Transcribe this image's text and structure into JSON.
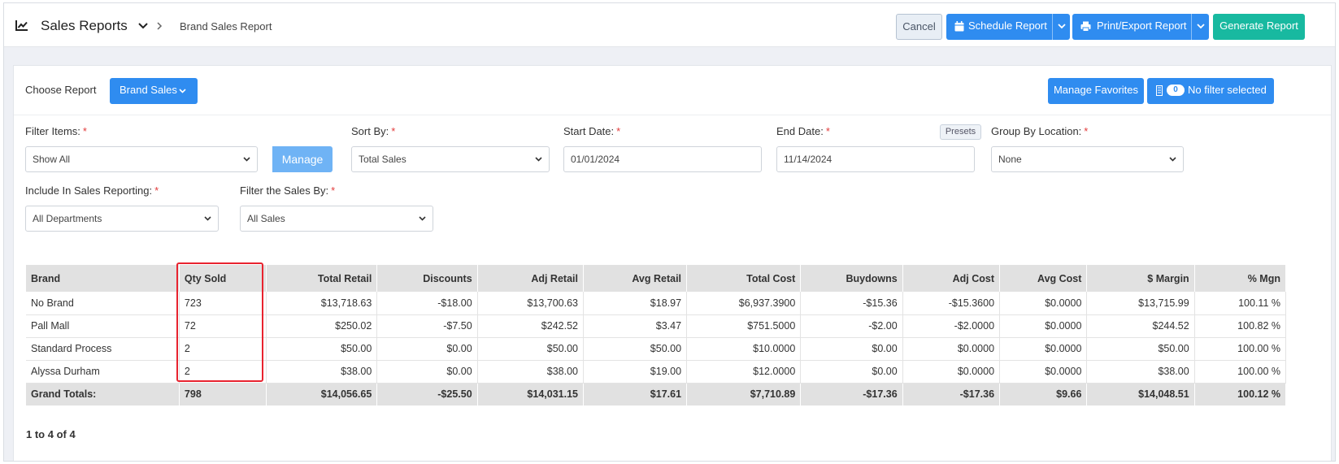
{
  "header": {
    "title": "Sales Reports",
    "breadcrumb": "Brand Sales Report",
    "cancel_label": "Cancel",
    "schedule_label": "Schedule Report",
    "print_label": "Print/Export Report",
    "generate_label": "Generate Report"
  },
  "report_bar": {
    "choose_label": "Choose Report",
    "report_selected": "Brand Sales",
    "manage_favorites_label": "Manage Favorites",
    "filter_count": "0",
    "filter_status": "No filter selected"
  },
  "filters": {
    "filter_items": {
      "label": "Filter Items:",
      "value": "Show All",
      "manage_label": "Manage"
    },
    "sort_by": {
      "label": "Sort By:",
      "value": "Total Sales"
    },
    "start_date": {
      "label": "Start Date:",
      "value": "01/01/2024"
    },
    "end_date": {
      "label": "End Date:",
      "value": "11/14/2024",
      "presets_label": "Presets"
    },
    "group_by_location": {
      "label": "Group By Location:",
      "value": "None"
    },
    "include_in_sales": {
      "label": "Include In Sales Reporting:",
      "value": "All Departments"
    },
    "filter_sales_by": {
      "label": "Filter the Sales By:",
      "value": "All Sales"
    },
    "required_mark": "*"
  },
  "table": {
    "columns": [
      "Brand",
      "Qty Sold",
      "Total Retail",
      "Discounts",
      "Adj Retail",
      "Avg Retail",
      "Total Cost",
      "Buydowns",
      "Adj Cost",
      "Avg Cost",
      "$ Margin",
      "% Mgn"
    ],
    "rows": [
      [
        "No Brand",
        "723",
        "$13,718.63",
        "-$18.00",
        "$13,700.63",
        "$18.97",
        "$6,937.3900",
        "-$15.36",
        "-$15.3600",
        "$0.0000",
        "$13,715.99",
        "100.11 %"
      ],
      [
        "Pall Mall",
        "72",
        "$250.02",
        "-$7.50",
        "$242.52",
        "$3.47",
        "$751.5000",
        "-$2.00",
        "-$2.0000",
        "$0.0000",
        "$244.52",
        "100.82 %"
      ],
      [
        "Standard Process",
        "2",
        "$50.00",
        "$0.00",
        "$50.00",
        "$50.00",
        "$10.0000",
        "$0.00",
        "$0.0000",
        "$0.0000",
        "$50.00",
        "100.00 %"
      ],
      [
        "Alyssa Durham",
        "2",
        "$38.00",
        "$0.00",
        "$38.00",
        "$19.00",
        "$12.0000",
        "$0.00",
        "$0.0000",
        "$0.0000",
        "$38.00",
        "100.00 %"
      ]
    ],
    "totals": [
      "Grand Totals:",
      "798",
      "$14,056.65",
      "-$25.50",
      "$14,031.15",
      "$17.61",
      "$7,710.89",
      "-$17.36",
      "-$17.36",
      "$9.66",
      "$14,048.51",
      "100.12 %"
    ]
  },
  "pager": "1 to 4 of 4",
  "colors": {
    "primary": "#2f8cf0",
    "teal": "#18b9a0",
    "highlight": "#e8232f"
  }
}
